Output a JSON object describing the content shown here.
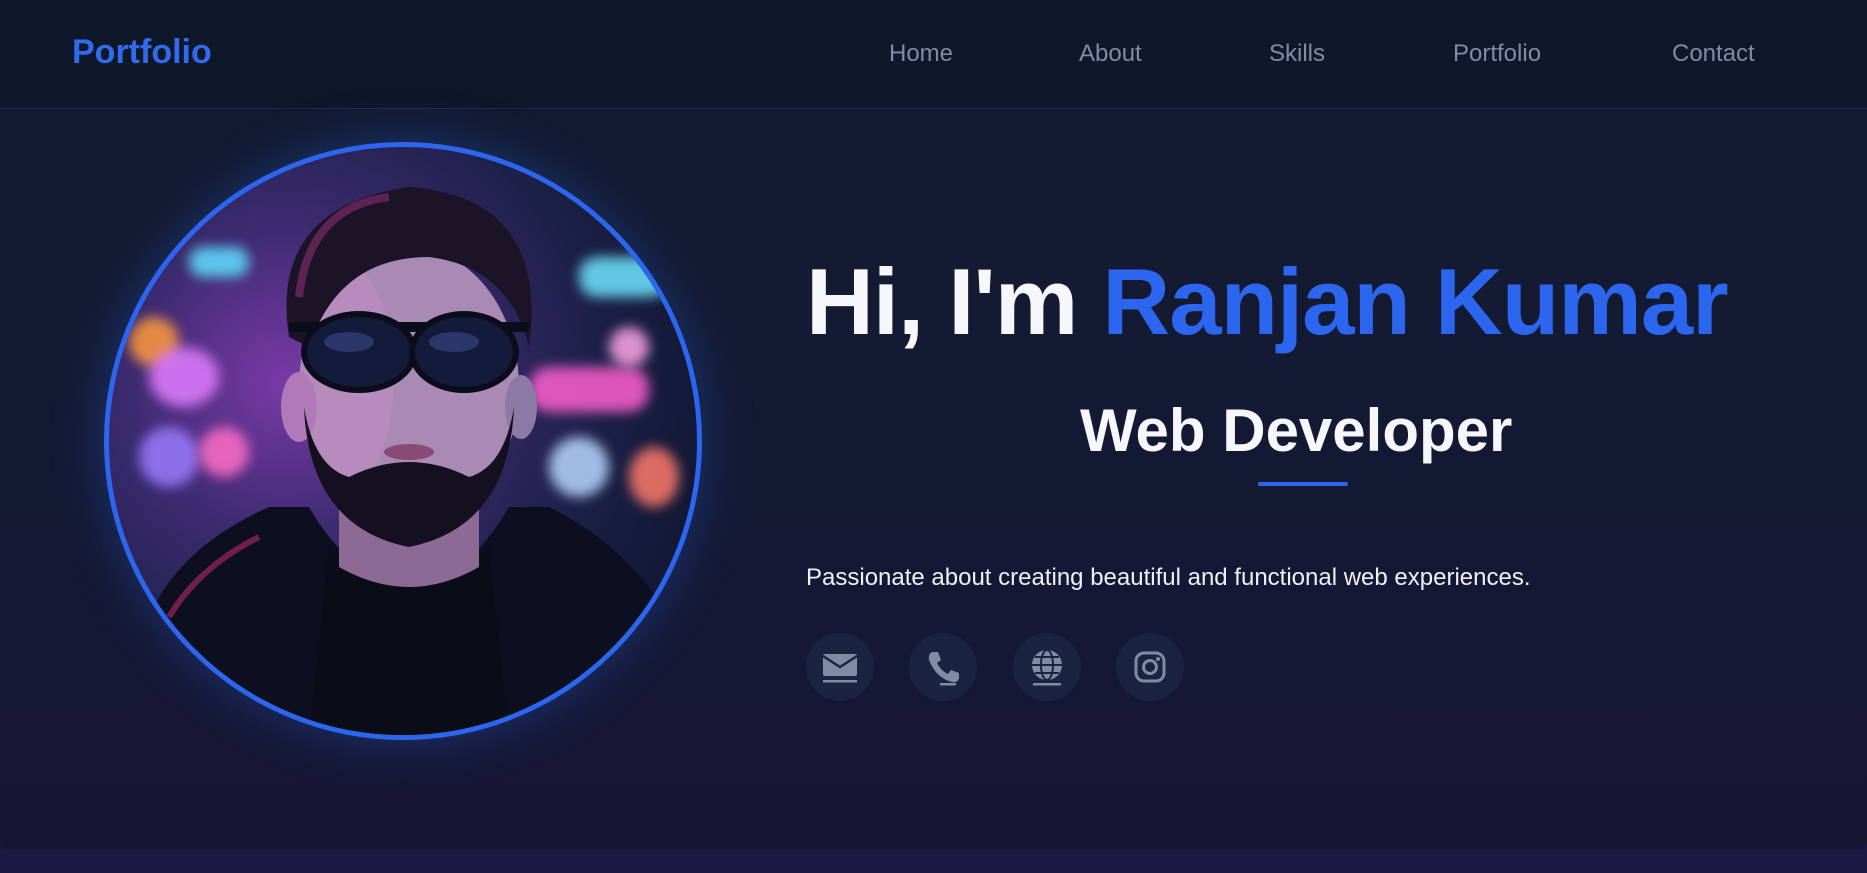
{
  "brand": "Portfolio",
  "nav": [
    "Home",
    "About",
    "Skills",
    "Portfolio",
    "Contact"
  ],
  "hero": {
    "greeting": "Hi, I'm",
    "name": "Ranjan Kumar",
    "role": "Web Developer",
    "tagline": "Passionate about creating beautiful and functional web experiences."
  },
  "social": [
    {
      "icon": "email-icon"
    },
    {
      "icon": "phone-icon"
    },
    {
      "icon": "globe-icon"
    },
    {
      "icon": "instagram-icon"
    }
  ],
  "colors": {
    "accent": "#2d66ee",
    "background": "#111a2e",
    "nav_text": "#7f8ca3",
    "icon": "#7f8ca3"
  }
}
